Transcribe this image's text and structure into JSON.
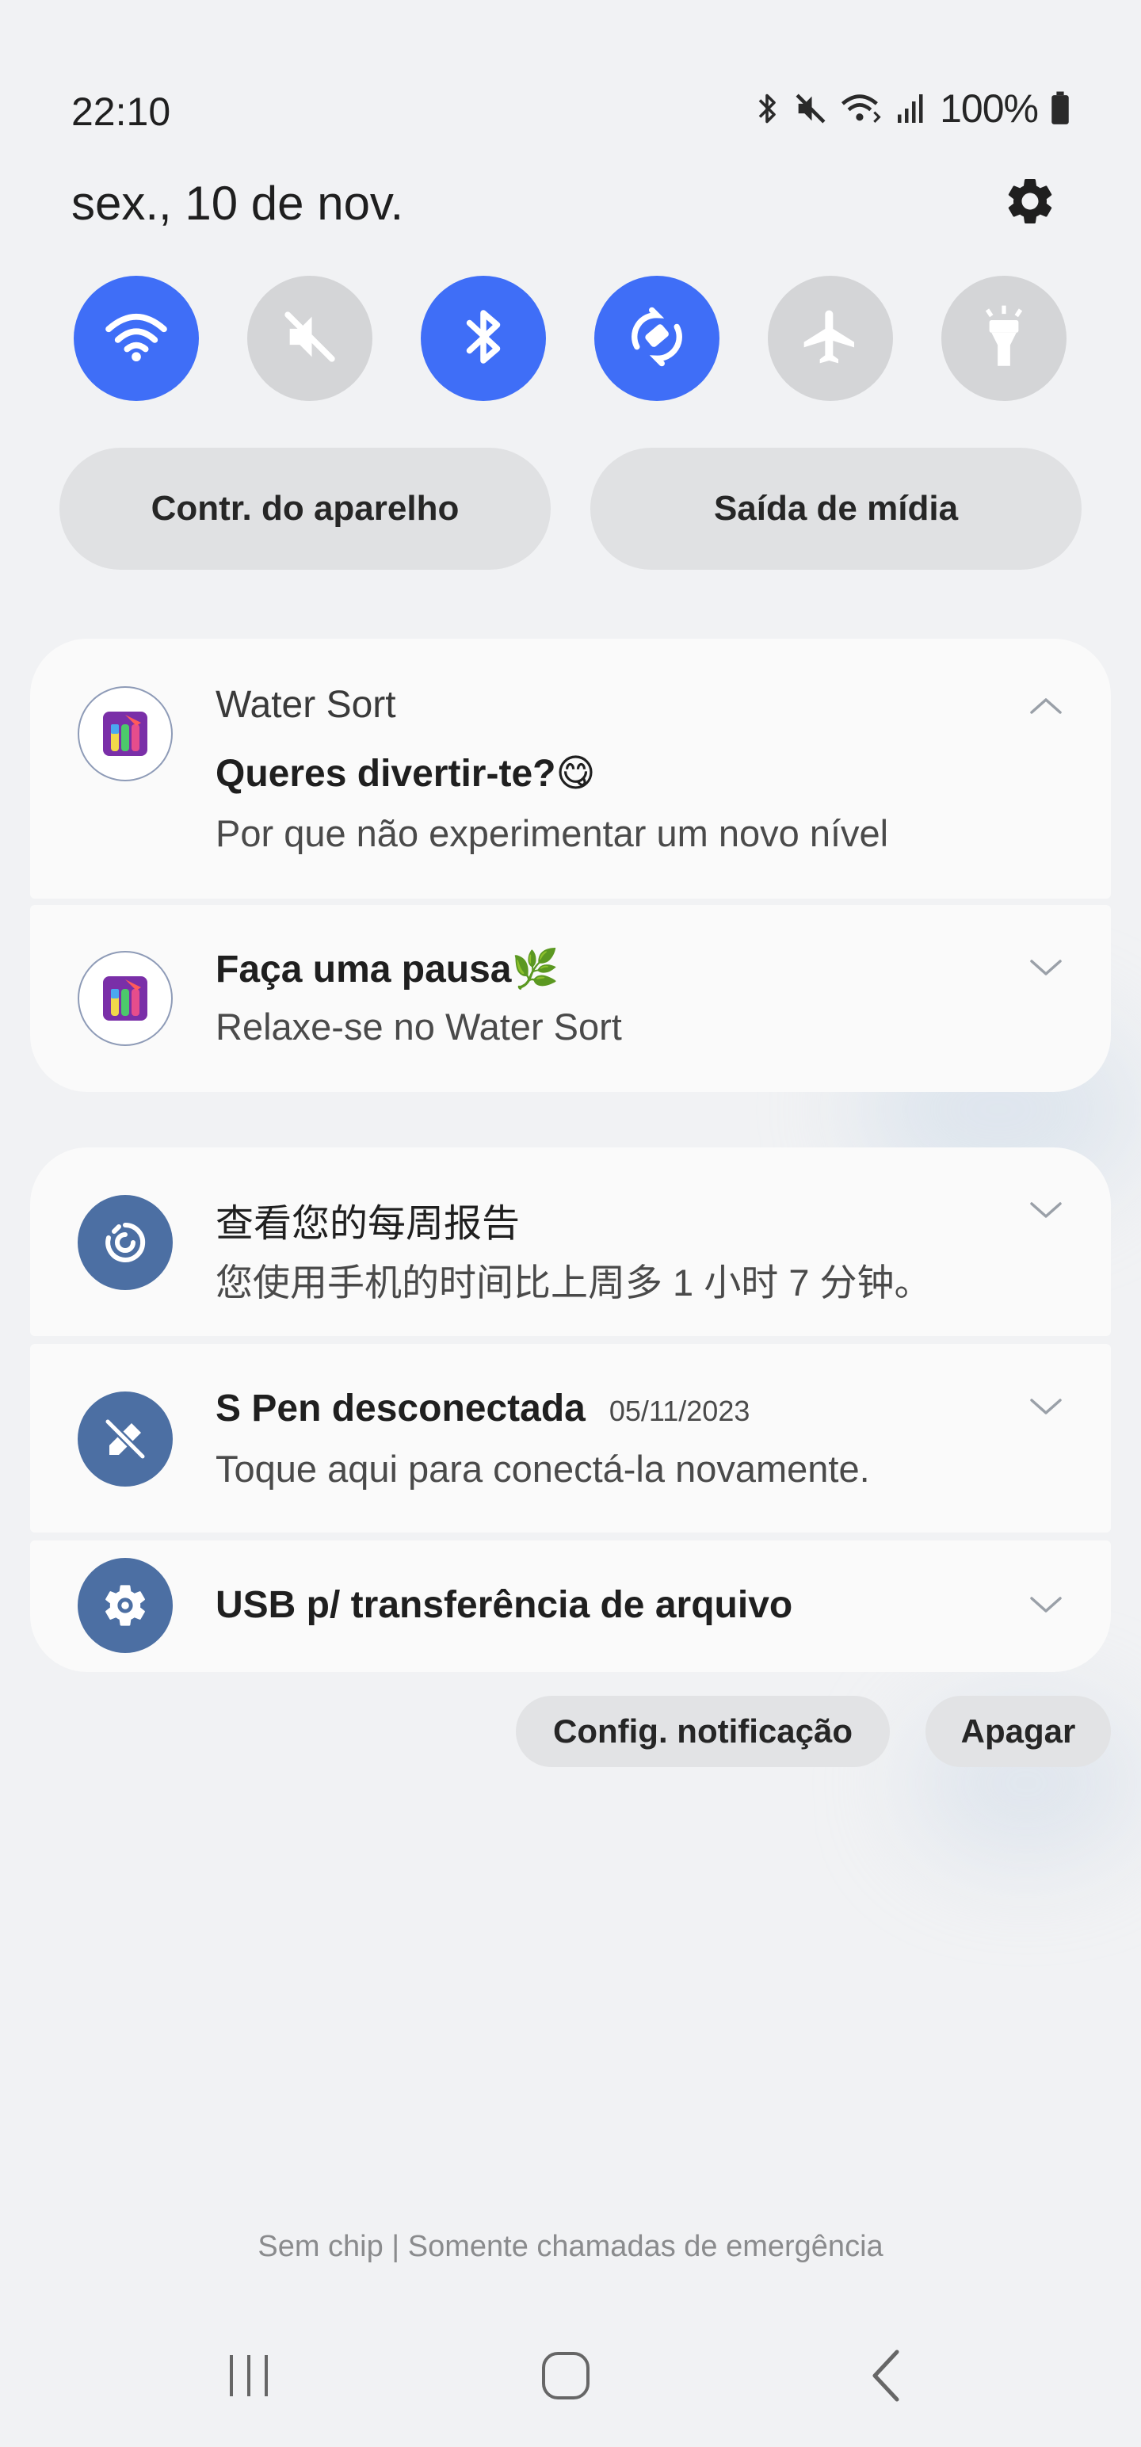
{
  "status_bar": {
    "time": "22:10",
    "battery": "100%",
    "icons": [
      "bluetooth-icon",
      "mute-icon",
      "wifi-icon",
      "signal-icon",
      "battery-icon"
    ]
  },
  "header": {
    "date": "sex., 10 de nov."
  },
  "quick_toggles": [
    {
      "name": "wifi",
      "state": "on"
    },
    {
      "name": "sound-muted",
      "state": "off"
    },
    {
      "name": "bluetooth",
      "state": "on"
    },
    {
      "name": "auto-rotate",
      "state": "on"
    },
    {
      "name": "airplane-mode",
      "state": "off"
    },
    {
      "name": "flashlight",
      "state": "off"
    }
  ],
  "pills": {
    "device_control": "Contr. do aparelho",
    "media_output": "Saída de mídia"
  },
  "notifications": {
    "water_sort": {
      "app_name": "Water Sort",
      "items": [
        {
          "title": "Queres divertir-te?😋",
          "body": "Por que não experimentar um novo nível"
        },
        {
          "title": "Faça uma pausa🌿",
          "body": "Relaxe-se no Water Sort"
        }
      ]
    },
    "system": [
      {
        "title": "查看您的每周报告",
        "body": "您使用手机的时间比上周多 1 小时 7 分钟。",
        "icon": "digital-wellbeing-icon"
      },
      {
        "title": "S Pen desconectada",
        "date": "05/11/2023",
        "body": "Toque aqui para conectá-la novamente.",
        "icon": "s-pen-off-icon"
      },
      {
        "title": "USB p/ transferência de arquivo",
        "icon": "usb-settings-icon"
      }
    ]
  },
  "actions": {
    "notification_settings": "Config. notificação",
    "clear": "Apagar"
  },
  "footer": {
    "carrier": "Sem chip | Somente chamadas de emergência"
  },
  "colors": {
    "accent": "#3f6ef7",
    "toggle_off": "#d4d5d7",
    "card": "#fafafa",
    "background": "#f1f2f4"
  }
}
